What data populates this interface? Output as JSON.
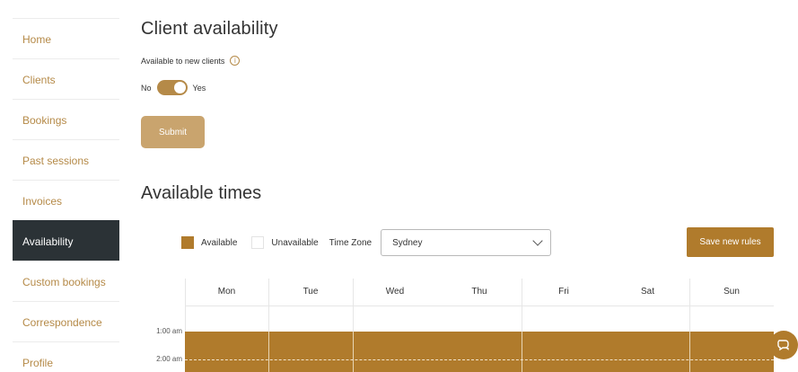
{
  "sidebar": {
    "items": [
      {
        "label": "Home",
        "active": false
      },
      {
        "label": "Clients",
        "active": false
      },
      {
        "label": "Bookings",
        "active": false
      },
      {
        "label": "Past sessions",
        "active": false
      },
      {
        "label": "Invoices",
        "active": false
      },
      {
        "label": "Availability",
        "active": true
      },
      {
        "label": "Custom bookings",
        "active": false
      },
      {
        "label": "Correspondence",
        "active": false
      },
      {
        "label": "Profile",
        "active": false
      }
    ]
  },
  "client_availability": {
    "title": "Client availability",
    "available_label": "Available to new clients",
    "toggle_off_label": "No",
    "toggle_on_label": "Yes",
    "toggle_value": true,
    "submit_label": "Submit"
  },
  "available_times": {
    "title": "Available times",
    "legend_available": "Available",
    "legend_unavailable": "Unavailable",
    "timezone_label": "Time Zone",
    "timezone_value": "Sydney",
    "save_label": "Save new rules",
    "days": [
      "Mon",
      "Tue",
      "Wed",
      "Thu",
      "Fri",
      "Sat",
      "Sun"
    ],
    "times": [
      "1:00 am",
      "2:00 am"
    ]
  },
  "colors": {
    "accent": "#b07b2c",
    "accent_light": "#c9a46e",
    "sidebar_active_bg": "#2b3236"
  },
  "icons": {
    "info": "info-icon",
    "dropdown": "chevron-down-icon",
    "chat": "chat-icon"
  }
}
